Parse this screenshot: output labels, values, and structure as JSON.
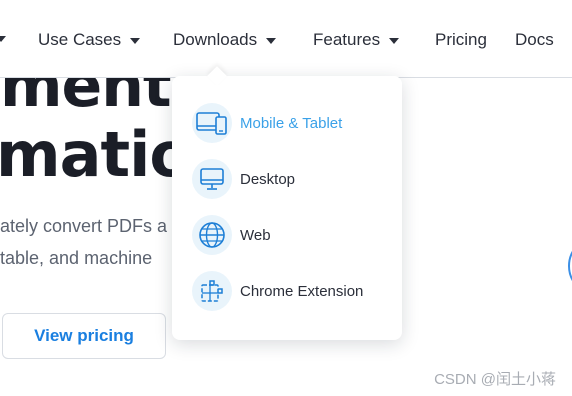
{
  "nav": {
    "items": [
      {
        "label": "Use Cases",
        "has_dropdown": true
      },
      {
        "label": "Downloads",
        "has_dropdown": true,
        "open": true
      },
      {
        "label": "Features",
        "has_dropdown": true
      },
      {
        "label": "Pricing",
        "has_dropdown": false
      },
      {
        "label": "Docs",
        "has_dropdown": false
      }
    ]
  },
  "hero": {
    "title_line1": "ment",
    "title_line2": "mation",
    "subtitle_line1": "ately convert PDFs a",
    "subtitle_line2": "table, and machine",
    "cta_label": "View pricing"
  },
  "downloads_menu": {
    "items": [
      {
        "label": "Mobile & Tablet",
        "icon": "mobile-tablet-icon",
        "active": true
      },
      {
        "label": "Desktop",
        "icon": "desktop-icon",
        "active": false
      },
      {
        "label": "Web",
        "icon": "globe-icon",
        "active": false
      },
      {
        "label": "Chrome Extension",
        "icon": "puzzle-icon",
        "active": false
      }
    ]
  },
  "watermark": "CSDN @闰土小蒋",
  "colors": {
    "accent": "#1a7fe0",
    "active_menu_text": "#3aa1e8",
    "icon_stroke": "#1e7fd6",
    "icon_bg": "#e9f4fb",
    "text": "#2b2f3a"
  }
}
